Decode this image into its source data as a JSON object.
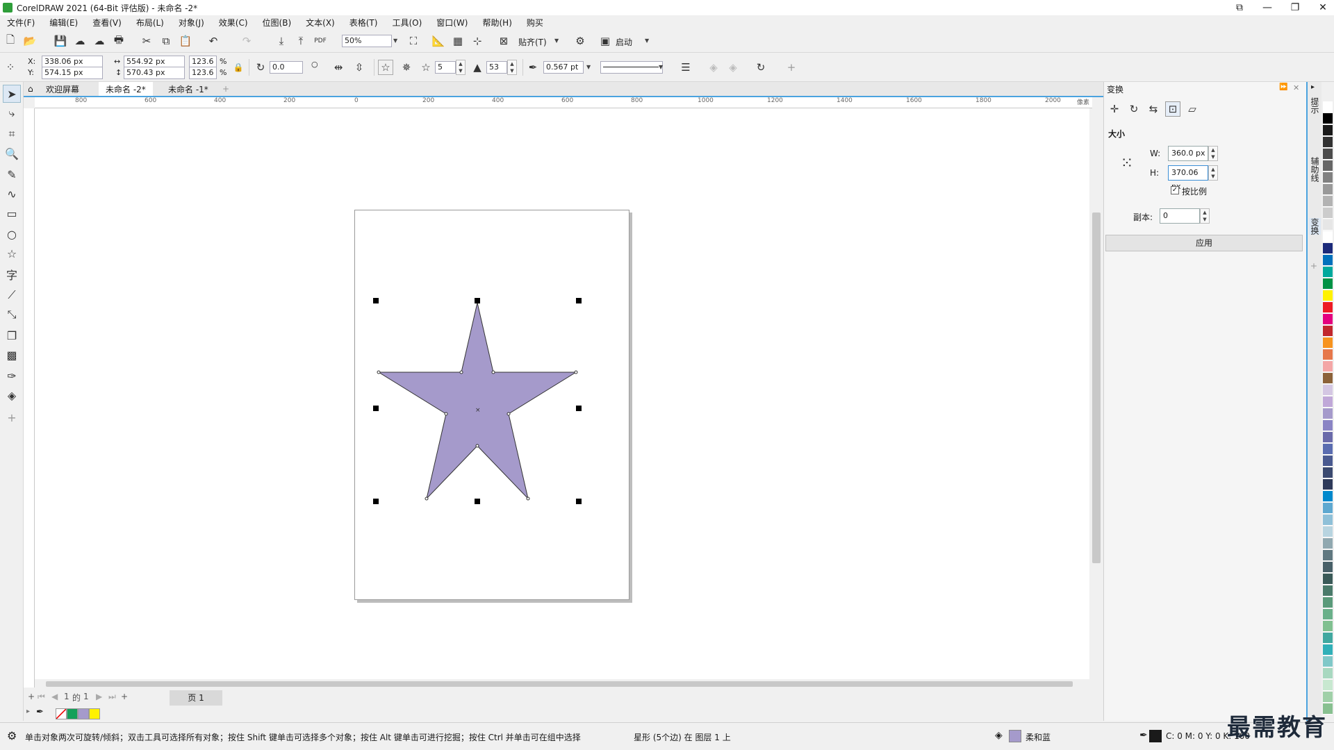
{
  "window": {
    "title": "CorelDRAW 2021 (64-Bit 评估版) - 未命名 -2*",
    "controls": [
      "restore-icon",
      "minimize-icon",
      "maximize-icon",
      "close-icon"
    ]
  },
  "menu": [
    "文件(F)",
    "编辑(E)",
    "查看(V)",
    "布局(L)",
    "对象(J)",
    "效果(C)",
    "位图(B)",
    "文本(X)",
    "表格(T)",
    "工具(O)",
    "窗口(W)",
    "帮助(H)",
    "购买"
  ],
  "standard_toolbar": {
    "zoom": "50%",
    "snap_label": "贴齐(T)",
    "launch_label": "启动"
  },
  "property_bar": {
    "x": "338.06 px",
    "y": "574.15 px",
    "width": "554.92 px",
    "height": "570.43 px",
    "scale_x": "123.6",
    "scale_y": "123.6",
    "percent": "%",
    "rotation": "0.0",
    "points": "5",
    "sharpness": "53",
    "outline_width": "0.567 pt"
  },
  "doc_tabs": [
    {
      "label": "欢迎屏幕",
      "active": false
    },
    {
      "label": "未命名 -2*",
      "active": true
    },
    {
      "label": "未命名 -1*",
      "active": false
    }
  ],
  "ruler": {
    "h_labels": [
      "800",
      "600",
      "400",
      "200",
      "0",
      "200",
      "400",
      "600",
      "800",
      "1000",
      "1200",
      "1400",
      "1600",
      "1800",
      "2000"
    ],
    "unit": "像素"
  },
  "page_nav": {
    "current": "1",
    "of": "的",
    "total": "1",
    "page_tab": "页 1"
  },
  "status": {
    "hint": "单击对象两次可旋转/倾斜；双击工具可选择所有对象；按住 Shift 键单击可选择多个对象；按住 Alt 键单击可进行挖掘；按住 Ctrl 并单击可在组中选择",
    "object_info": "星形 (5个边) 在 图层 1 上",
    "fill_name": "柔和蓝",
    "outline_info": "C: 0 M: 0 Y: 0 K: 100"
  },
  "docker": {
    "title": "变换",
    "section": "大小",
    "w_label": "W:",
    "w_value": "360.0 px",
    "h_label": "H:",
    "h_value": "370.06 px",
    "proportional": "按比例",
    "copies_label": "副本:",
    "copies_value": "0",
    "apply": "应用"
  },
  "side_tabs": [
    "提示",
    "辅助线",
    "变换"
  ],
  "colors": {
    "star_fill": "#a59acb",
    "star_outline": "#333333",
    "accent": "#4aa3df"
  },
  "document_palette": [
    "#ffffff",
    "#14a05a",
    "#a59acb",
    "#fff200"
  ],
  "color_palette": [
    "#ffffff",
    "#000000",
    "#1a1a1a",
    "#333333",
    "#4d4d4d",
    "#666666",
    "#808080",
    "#999999",
    "#b3b3b3",
    "#cccccc",
    "#e6e6e6",
    "#ffffff",
    "#1c2a7a",
    "#0071bc",
    "#00a99d",
    "#009245",
    "#fff200",
    "#ed1c24",
    "#e4007f",
    "#c1272d",
    "#f7931e",
    "#e6784b",
    "#f4a6a6",
    "#8c6239",
    "#d4c7e3",
    "#c0a8d8",
    "#a59acb",
    "#8a84c4",
    "#6a6aaa",
    "#5a6cb0",
    "#4a5a90",
    "#3b4a70",
    "#2e3a5a",
    "#0088cc",
    "#5ea8d0",
    "#8fc0d8",
    "#b8d4e0",
    "#90a8b0",
    "#607880",
    "#486068",
    "#3a5a58",
    "#4a7a6a",
    "#5a9a7a",
    "#6ab08a",
    "#80c090",
    "#40a8a0",
    "#30b0b8",
    "#80c8c8",
    "#a8d8c0",
    "#c8e8d0",
    "#a0d0a8",
    "#88c090"
  ],
  "watermark": "最需教育"
}
